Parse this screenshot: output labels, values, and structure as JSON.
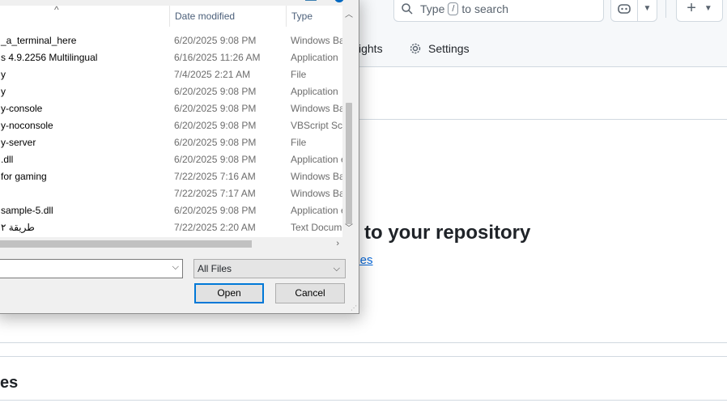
{
  "github": {
    "search": {
      "prefix": "Type",
      "key": "/",
      "suffix": "to search"
    },
    "tabs": [
      {
        "label": "sights"
      },
      {
        "label": "Settings"
      }
    ],
    "heading": "to your repository",
    "link": "iles",
    "bottom_heading": "es",
    "colors": {
      "link": "#0969da",
      "border": "#d1d9e0",
      "header_bg": "#f6f8fa"
    }
  },
  "dialog": {
    "columns": {
      "date": "Date modified",
      "type": "Type"
    },
    "files": [
      {
        "name": "_a_terminal_here",
        "date": "6/20/2025 9:08 PM",
        "type": "Windows Bat"
      },
      {
        "name": "s 4.9.2256 Multilingual",
        "date": "6/16/2025 11:26 AM",
        "type": "Application"
      },
      {
        "name": "y",
        "date": "7/4/2025 2:21 AM",
        "type": "File"
      },
      {
        "name": "y",
        "date": "6/20/2025 9:08 PM",
        "type": "Application"
      },
      {
        "name": "y-console",
        "date": "6/20/2025 9:08 PM",
        "type": "Windows Bat"
      },
      {
        "name": "y-noconsole",
        "date": "6/20/2025 9:08 PM",
        "type": "VBScript Scri"
      },
      {
        "name": "y-server",
        "date": "6/20/2025 9:08 PM",
        "type": "File"
      },
      {
        "name": ".dll",
        "date": "6/20/2025 9:08 PM",
        "type": "Application e"
      },
      {
        "name": "for gaming",
        "date": "7/22/2025 7:16 AM",
        "type": "Windows Bat"
      },
      {
        "name": "",
        "date": "7/22/2025 7:17 AM",
        "type": "Windows Bat"
      },
      {
        "name": "sample-5.dll",
        "date": "6/20/2025 9:08 PM",
        "type": "Application e"
      },
      {
        "name": "طريقة ٢",
        "date": "7/22/2025 2:20 AM",
        "type": "Text Docume"
      }
    ],
    "filename_value": "",
    "filter_value": "All Files",
    "open_label": "Open",
    "cancel_label": "Cancel"
  }
}
